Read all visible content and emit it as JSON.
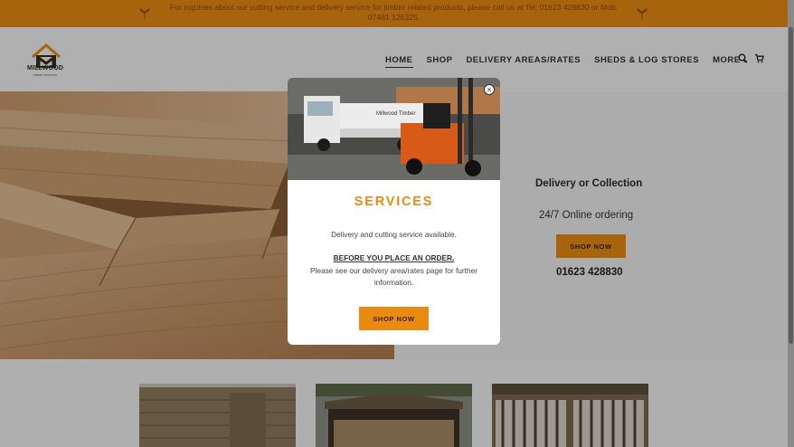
{
  "announcement": {
    "text": "For inquiries about our cutting service and delivery service for timber related products, please call us at Tel: 01623 428830 or Mob: 07481 126325."
  },
  "brand": {
    "name": "MILLWOOD",
    "tagline": "TIMBER SUPPLIES"
  },
  "nav": {
    "items": [
      "HOME",
      "SHOP",
      "DELIVERY AREAS/RATES",
      "SHEDS & LOG STORES",
      "MORE"
    ],
    "active": "HOME"
  },
  "hero": {
    "heading": "Delivery or Collection",
    "subheading": "24/7 Online ordering",
    "button_label": "SHOP NOW",
    "phone": "01623 428830"
  },
  "modal": {
    "title": "SERVICES",
    "line1": "Delivery and cutting service available.",
    "line2": "BEFORE YOU PLACE AN ORDER.",
    "line3": "Please see our delivery area/rates page for further information.",
    "button_label": "SHOP NOW",
    "van_text": "Millwood Timber"
  },
  "colors": {
    "accent": "#e98a12",
    "text_dark": "#2b2b2b",
    "background": "#f3f3f3"
  }
}
